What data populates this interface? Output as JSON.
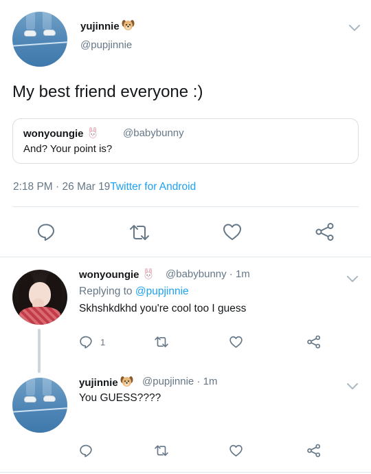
{
  "main_tweet": {
    "author_name": "yujinnie",
    "author_emoji": "dog-face-emoji",
    "author_handle": "@pupjinnie",
    "text": "My best friend everyone :)",
    "quoted": {
      "author_name": "wonyoungie",
      "author_emoji": "rabbit-face-emoji",
      "author_handle": "@babybunny",
      "text": "And? Your point is?"
    },
    "time": "2:18 PM",
    "separator": " · ",
    "date": "26 Mar 19",
    "source": "Twitter for Android"
  },
  "replies": [
    {
      "author_name": "wonyoungie",
      "author_emoji": "rabbit-face-emoji",
      "author_handle": "@babybunny",
      "age": "· 1m",
      "replying_prefix": "Replying to ",
      "replying_to": "@pupjinnie",
      "text": "Skhshkdkhd you're cool too I guess",
      "reply_count": "1"
    },
    {
      "author_name": "yujinnie",
      "author_emoji": "dog-face-emoji",
      "author_handle": "@pupjinnie",
      "age": "· 1m",
      "text": "You GUESS????"
    }
  ],
  "colors": {
    "text": "#14171a",
    "secondary": "#657786",
    "accent": "#1da1f2",
    "divider": "#e1e8ed"
  }
}
